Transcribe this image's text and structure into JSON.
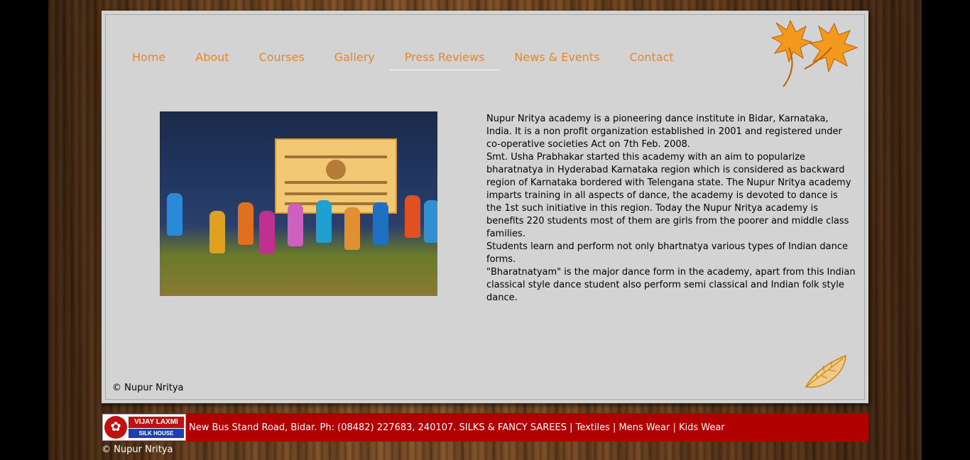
{
  "nav": {
    "items": [
      "Home",
      "About",
      "Courses",
      "Gallery",
      "Press Reviews",
      "News & Events",
      "Contact"
    ],
    "active": "Press Reviews"
  },
  "photo": {
    "name": "dance-performance-photo"
  },
  "description": {
    "paragraphs": [
      "Nupur Nritya academy is a pioneering dance institute in Bidar, Karnataka, India. It is a non profit organization established in 2001 and registered under co-operative societies Act on 7th Feb. 2008.",
      "Smt. Usha Prabhakar started this academy with an aim to popularize bharatnatya in Hyderabad Karnataka region which is considered as backward region of Karnataka bordered with Telengana state. The Nupur Nritya academy imparts training in all aspects of dance, the academy is devoted to dance is the 1st such initiative in this region. Today the Nupur Nritya academy is benefits 220 students most of them are girls from the poorer and middle class families.",
      "Students learn and perform not only bhartnatya various types of Indian dance forms.",
      "\"Bharatnatyam\" is the major dance form in the academy, apart from this Indian classical style dance student also perform semi classical and Indian folk style dance."
    ]
  },
  "panel_copyright": "© Nupur Nritya",
  "ad": {
    "logo_top": "VIJAY LAXMI",
    "logo_bottom": "SILK HOUSE",
    "text": "New Bus Stand Road, Bidar. Ph: (08482) 227683, 240107. SILKS & FANCY SAREES | Textiles | Mens Wear | Kids Wear"
  },
  "page_copyright": "© Nupur Nritya",
  "colors": {
    "nav": "#e8862a",
    "panel": "#d3d3d3",
    "ad_bar": "#b00000"
  }
}
